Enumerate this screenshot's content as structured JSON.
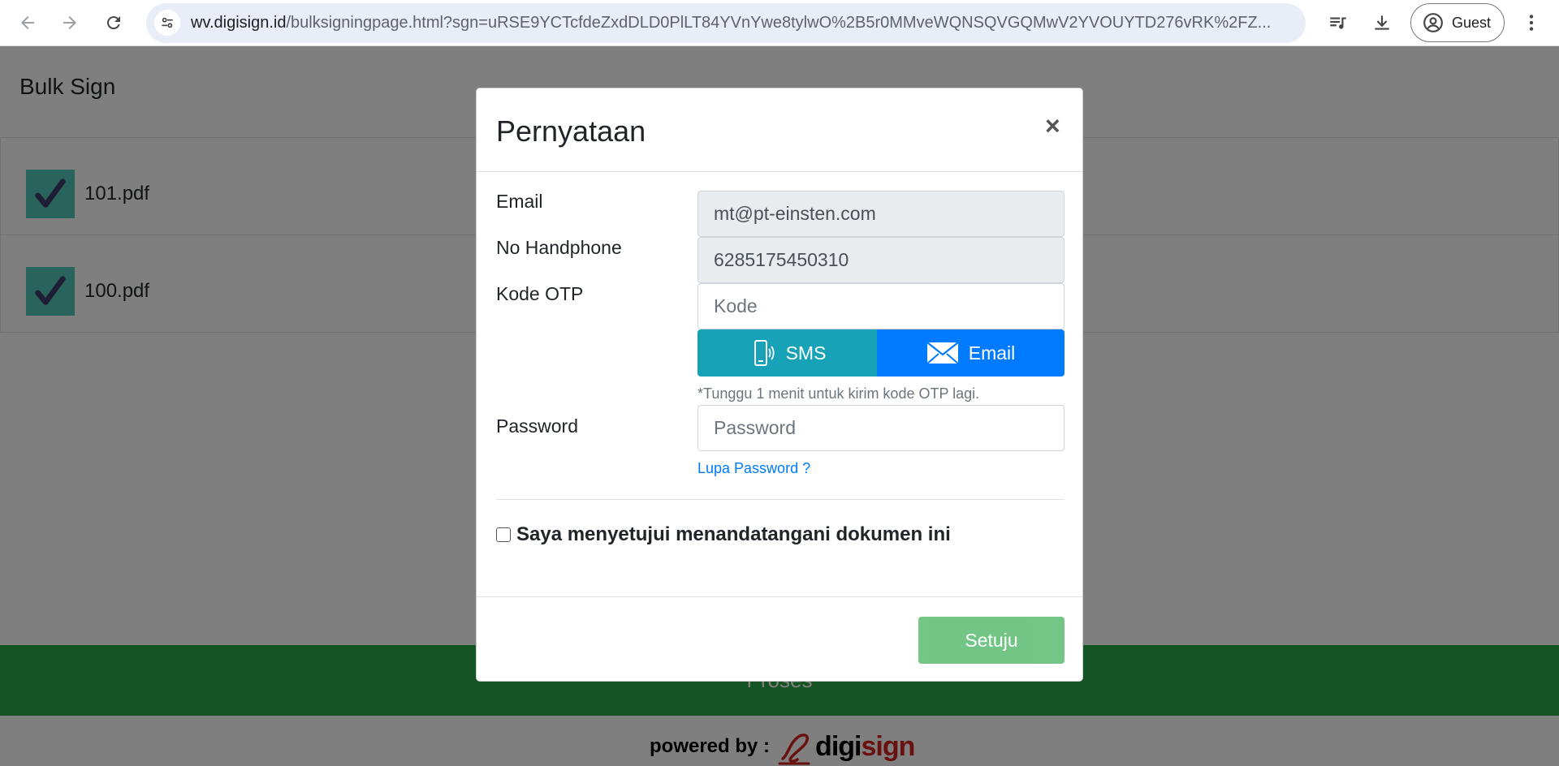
{
  "browser": {
    "url_host": "wv.digisign.id",
    "url_rest": "/bulksigningpage.html?sgn=uRSE9YCTcfdeZxdDLD0PlLT84YVnYwe8tylwO%2B5r0MMveWQNSQVGQMwV2YVOUYTD276vRK%2FZ...",
    "profile_label": "Guest"
  },
  "page": {
    "title": "Bulk Sign",
    "documents": [
      {
        "name": "101.pdf",
        "checked": true
      },
      {
        "name": "100.pdf",
        "checked": true
      }
    ],
    "proses_label": "Proses",
    "powered_by": "powered by :",
    "logo_text_black": "d",
    "logo_text_red_1": "igi",
    "logo_text_red_2": "sign"
  },
  "modal": {
    "title": "Pernyataan",
    "close_label": "×",
    "email_label": "Email",
    "email_value": "mt@pt-einsten.com",
    "phone_label": "No Handphone",
    "phone_value": "6285175450310",
    "otp_label": "Kode OTP",
    "otp_placeholder": "Kode",
    "sms_label": "SMS",
    "email_btn_label": "Email",
    "otp_note": "*Tunggu 1 menit untuk kirim kode OTP lagi.",
    "password_label": "Password",
    "password_placeholder": "Password",
    "forgot_label": "Lupa Password ?",
    "agree_label": "Saya menyetujui menandatangani dokumen ini",
    "agree_checked": false,
    "submit_label": "Setuju"
  },
  "colors": {
    "proses_green": "#28a745",
    "sms_teal": "#17a2b8",
    "email_blue": "#007bff",
    "check_teal": "#50c8b8",
    "brand_red": "#d5201f"
  }
}
